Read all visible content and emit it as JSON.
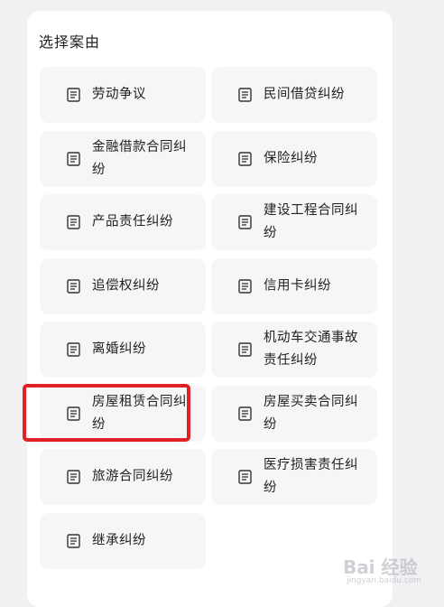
{
  "section": {
    "title": "选择案由"
  },
  "items": [
    {
      "label": "劳动争议",
      "icon": "document-icon"
    },
    {
      "label": "民间借贷纠纷",
      "icon": "document-icon"
    },
    {
      "label": "金融借款合同纠纷",
      "icon": "document-icon"
    },
    {
      "label": "保险纠纷",
      "icon": "document-icon"
    },
    {
      "label": "产品责任纠纷",
      "icon": "document-icon"
    },
    {
      "label": "建设工程合同纠纷",
      "icon": "document-icon"
    },
    {
      "label": "追偿权纠纷",
      "icon": "document-icon"
    },
    {
      "label": "信用卡纠纷",
      "icon": "document-icon"
    },
    {
      "label": "离婚纠纷",
      "icon": "document-icon"
    },
    {
      "label": "机动车交通事故责任纠纷",
      "icon": "document-icon"
    },
    {
      "label": "房屋租赁合同纠纷",
      "icon": "document-icon",
      "highlighted": true
    },
    {
      "label": "房屋买卖合同纠纷",
      "icon": "document-icon"
    },
    {
      "label": "旅游合同纠纷",
      "icon": "document-icon"
    },
    {
      "label": "医疗损害责任纠纷",
      "icon": "document-icon"
    },
    {
      "label": "继承纠纷",
      "icon": "document-icon"
    }
  ],
  "watermark": {
    "text": "Bai 经验",
    "sub": "jingyan.baidu.com"
  },
  "colors": {
    "highlight": "#e02227",
    "tile": "#f6f6f8",
    "background": "#f1f1f3"
  }
}
